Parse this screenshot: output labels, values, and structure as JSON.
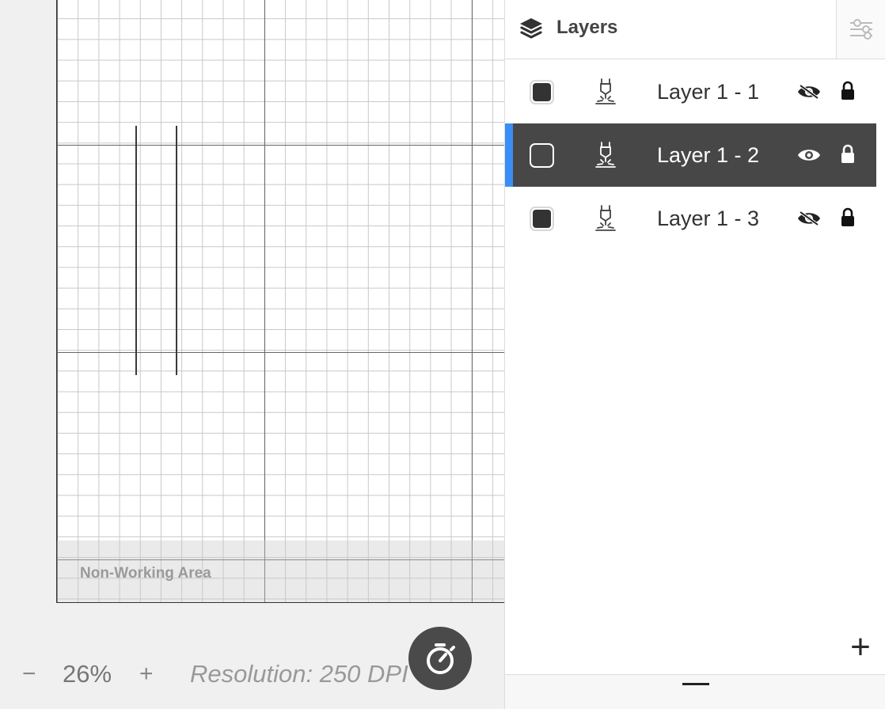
{
  "canvas": {
    "non_working_label": "Non-Working Area"
  },
  "zoom": {
    "minus": "−",
    "value": "26%",
    "plus": "+"
  },
  "status": {
    "resolution": "Resolution: 250 DPI"
  },
  "timer": {
    "icon": "stopwatch-icon"
  },
  "panel": {
    "title": "Layers",
    "title_icon": "layers-stack-icon",
    "settings_icon": "sliders-icon",
    "add_label": "+",
    "accent_color": "#3a8ef6",
    "selected_bg": "#474747"
  },
  "layers": [
    {
      "name": "Layer 1 - 1",
      "selected": false,
      "visibility_icon": "eye-off-icon",
      "lock_icon": "lock-icon"
    },
    {
      "name": "Layer 1 - 2",
      "selected": true,
      "visibility_icon": "eye-icon",
      "lock_icon": "lock-icon"
    },
    {
      "name": "Layer 1 - 3",
      "selected": false,
      "visibility_icon": "eye-off-icon",
      "lock_icon": "lock-icon"
    }
  ]
}
